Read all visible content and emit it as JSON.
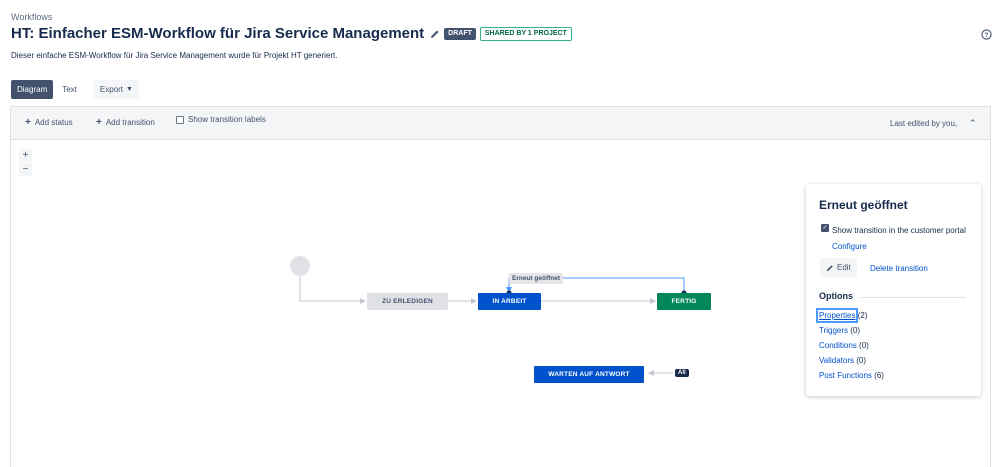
{
  "breadcrumb": "Workflows",
  "title": "HT: Einfacher ESM-Workflow für Jira Service Management",
  "badges": {
    "draft": "DRAFT",
    "shared": "SHARED BY 1 PROJECT"
  },
  "description": "Dieser einfache ESM-Workflow für Jira Service Management wurde für Projekt HT generiert.",
  "tabs": {
    "diagram": "Diagram",
    "text": "Text",
    "export": "Export"
  },
  "toolbar": {
    "add_status": "Add status",
    "add_transition": "Add transition",
    "show_labels": "Show transition labels",
    "last_edited": "Last edited by you,"
  },
  "zoom": {
    "in": "+",
    "out": "−"
  },
  "diagram": {
    "statuses": {
      "todo": "ZU ERLEDIGEN",
      "in_progress": "IN ARBEIT",
      "done": "FERTIG",
      "waiting": "WARTEN AUF ANTWORT"
    },
    "transition_label": "Erneut geöffnet",
    "all_badge": "All"
  },
  "panel": {
    "title": "Erneut geöffnet",
    "checkbox_text": "Show transition in the customer portal",
    "configure": "Configure",
    "edit": "Edit",
    "delete": "Delete transition",
    "options_heading": "Options",
    "options": [
      {
        "label": "Properties",
        "count": "(2)"
      },
      {
        "label": "Triggers",
        "count": "(0)"
      },
      {
        "label": "Conditions",
        "count": "(0)"
      },
      {
        "label": "Validators",
        "count": "(0)"
      },
      {
        "label": "Post Functions",
        "count": "(6)"
      }
    ]
  },
  "colors": {
    "todo": "#dfe1e6",
    "in_progress": "#0052cc",
    "done": "#00875a",
    "link": "#0052cc"
  }
}
